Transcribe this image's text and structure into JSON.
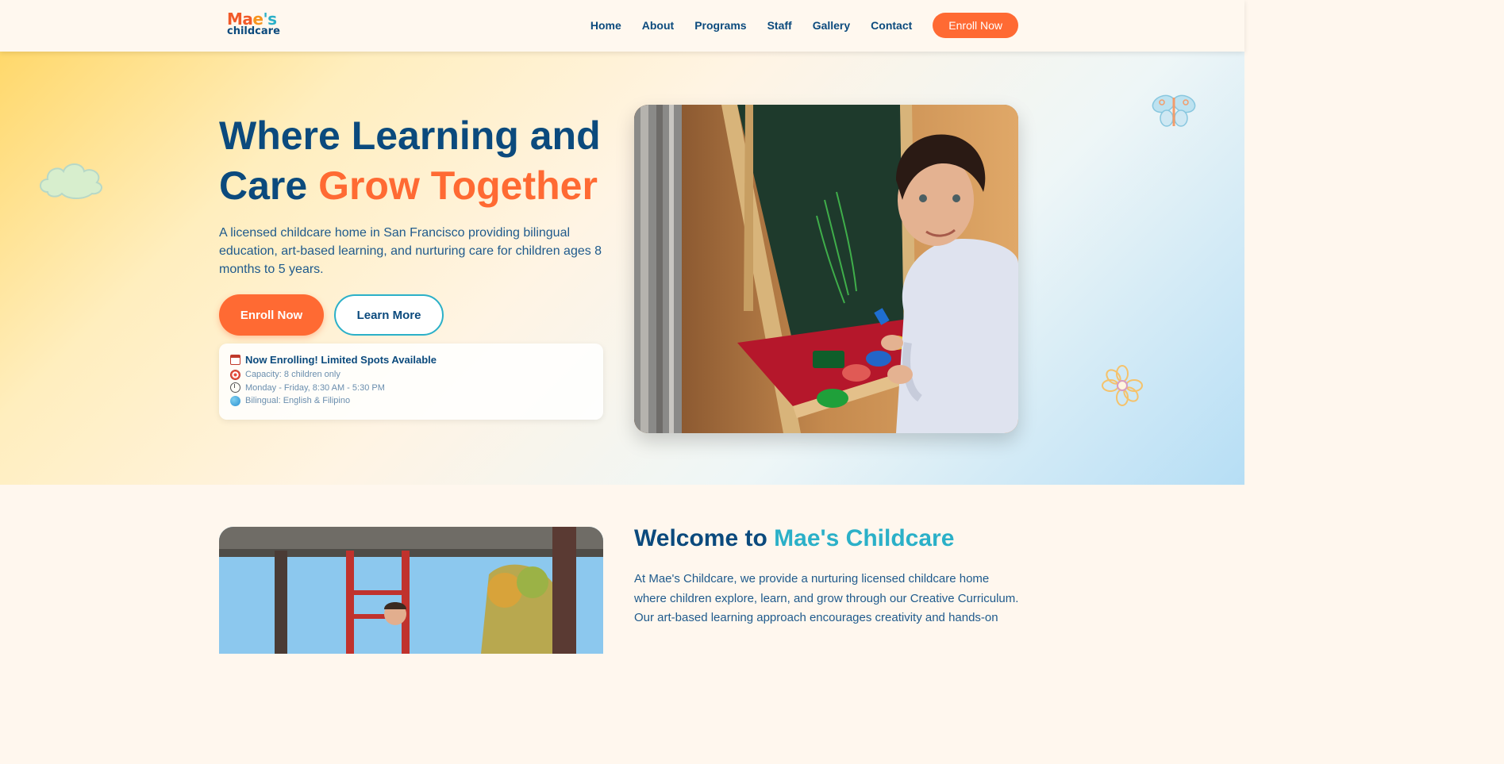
{
  "header": {
    "logo": {
      "top_part1": "Ma",
      "top_part2": "e",
      "top_part3": "'s",
      "bottom": "childcare"
    },
    "nav": [
      "Home",
      "About",
      "Programs",
      "Staff",
      "Gallery",
      "Contact"
    ],
    "enroll_label": "Enroll Now"
  },
  "hero": {
    "title_line1": "Where Learning and",
    "title_line2_plain": "Care ",
    "title_line2_accent": "Grow Together",
    "subtitle": "A licensed childcare home in San Francisco providing bilingual education, art-based learning, and nurturing care for children ages 8 months to 5 years.",
    "primary_button": "Enroll Now",
    "secondary_button": "Learn More",
    "info": {
      "heading": "Now Enrolling! Limited Spots Available",
      "rows": [
        "Capacity: 8 children only",
        "Monday - Friday, 8:30 AM - 5:30 PM",
        "Bilingual: English & Filipino"
      ]
    }
  },
  "welcome": {
    "title_plain": "Welcome to ",
    "title_accent": "Mae's Childcare",
    "text": "At Mae's Childcare, we provide a nurturing licensed childcare home where children explore, learn, and grow through our Creative Curriculum. Our art-based learning approach encourages creativity and hands-on"
  },
  "colors": {
    "brand_navy": "#0b4a7d",
    "accent_orange": "#ff6a33",
    "accent_teal": "#2bb0c8"
  },
  "icons": [
    "calendar-icon",
    "target-icon",
    "clock-icon",
    "globe-icon",
    "cloud-icon",
    "butterfly-icon",
    "flower-icon"
  ]
}
